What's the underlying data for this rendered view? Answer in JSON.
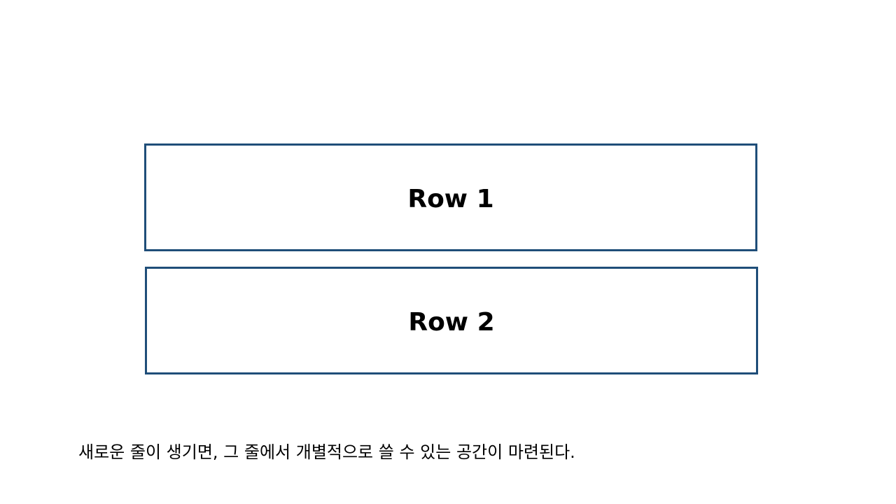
{
  "rows": [
    {
      "label": "Row 1"
    },
    {
      "label": "Row 2"
    }
  ],
  "caption": "새로운 줄이 생기면, 그 줄에서 개별적으로 쓸 수 있는 공간이 마련된다.",
  "colors": {
    "border": "#1f4e79",
    "text": "#000000",
    "background": "#ffffff"
  }
}
